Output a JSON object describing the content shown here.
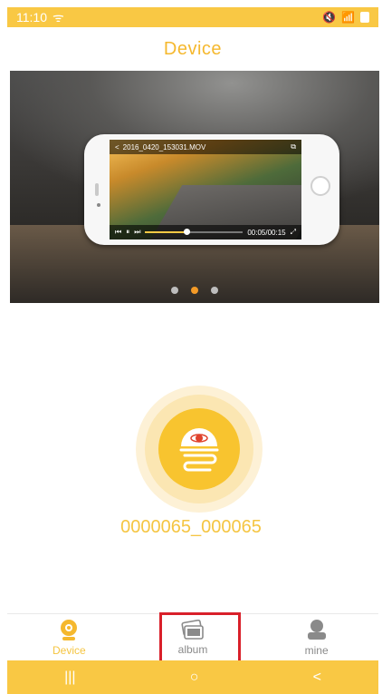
{
  "status_bar": {
    "time": "11:10",
    "signal_text": "ᯤ",
    "right_text": "📶"
  },
  "header": {
    "title": "Device"
  },
  "banner": {
    "video_filename": "2016_0420_153031.MOV",
    "video_time": "00:05/00:15",
    "progress": 0.42,
    "active_dot": 1
  },
  "device": {
    "name": "0000065_000065"
  },
  "tabs": [
    {
      "label": "Device",
      "icon": "camera-icon",
      "active": true
    },
    {
      "label": "album",
      "icon": "album-icon",
      "active": false
    },
    {
      "label": "mine",
      "icon": "user-icon",
      "active": false
    }
  ],
  "navbar": {
    "recent": "|||",
    "home": "○",
    "back": "<"
  },
  "colors": {
    "accent": "#f9c844",
    "accent_text": "#f5c542",
    "active_dot": "#f39a27",
    "highlight": "#d9202a"
  }
}
